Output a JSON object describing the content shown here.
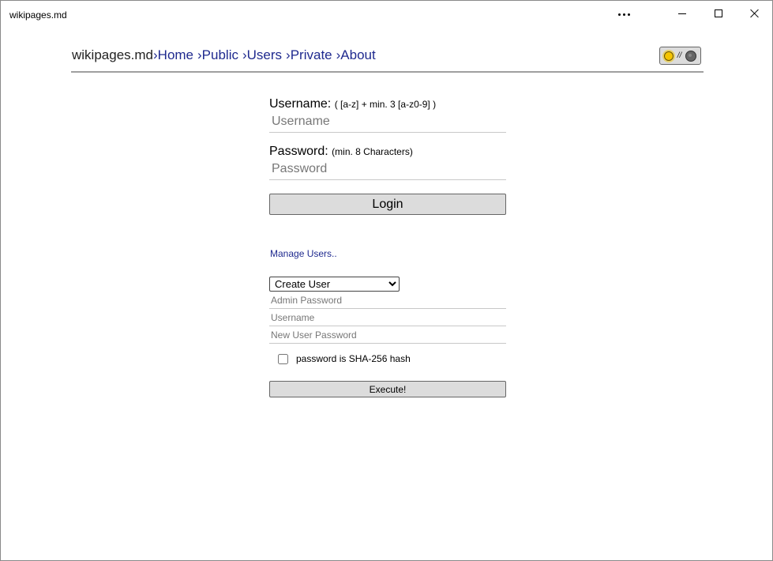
{
  "window": {
    "title": "wikipages.md",
    "more_icon": "more-dots-icon",
    "minimize_icon": "minimize-icon",
    "maximize_icon": "maximize-icon",
    "close_icon": "close-icon"
  },
  "nav": {
    "brand": "wikipages.md",
    "links": [
      {
        "label": "›Home"
      },
      {
        "label": "›Public"
      },
      {
        "label": "›Users"
      },
      {
        "label": "›Private"
      },
      {
        "label": "›About"
      }
    ],
    "theme_toggle": {
      "separator": "//",
      "light_icon": "sun-icon",
      "dark_icon": "moon-icon"
    }
  },
  "login": {
    "username_label": "Username:",
    "username_hint": "( [a-z] + min. 3 [a-z0-9] )",
    "username_placeholder": "Username",
    "password_label": "Password:",
    "password_hint": "(min. 8 Characters)",
    "password_placeholder": "Password",
    "login_button": "Login"
  },
  "manage": {
    "link_label": "Manage Users..",
    "action_selected": "Create User",
    "admin_password_placeholder": "Admin Password",
    "username_placeholder": "Username",
    "new_password_placeholder": "New User Password",
    "sha_checkbox_label": "password is SHA-256 hash",
    "sha_checked": false,
    "execute_button": "Execute!"
  },
  "colors": {
    "link": "#1f2a8f",
    "button_bg": "#dcdcdc",
    "nav_border": "#a0a0a0"
  }
}
